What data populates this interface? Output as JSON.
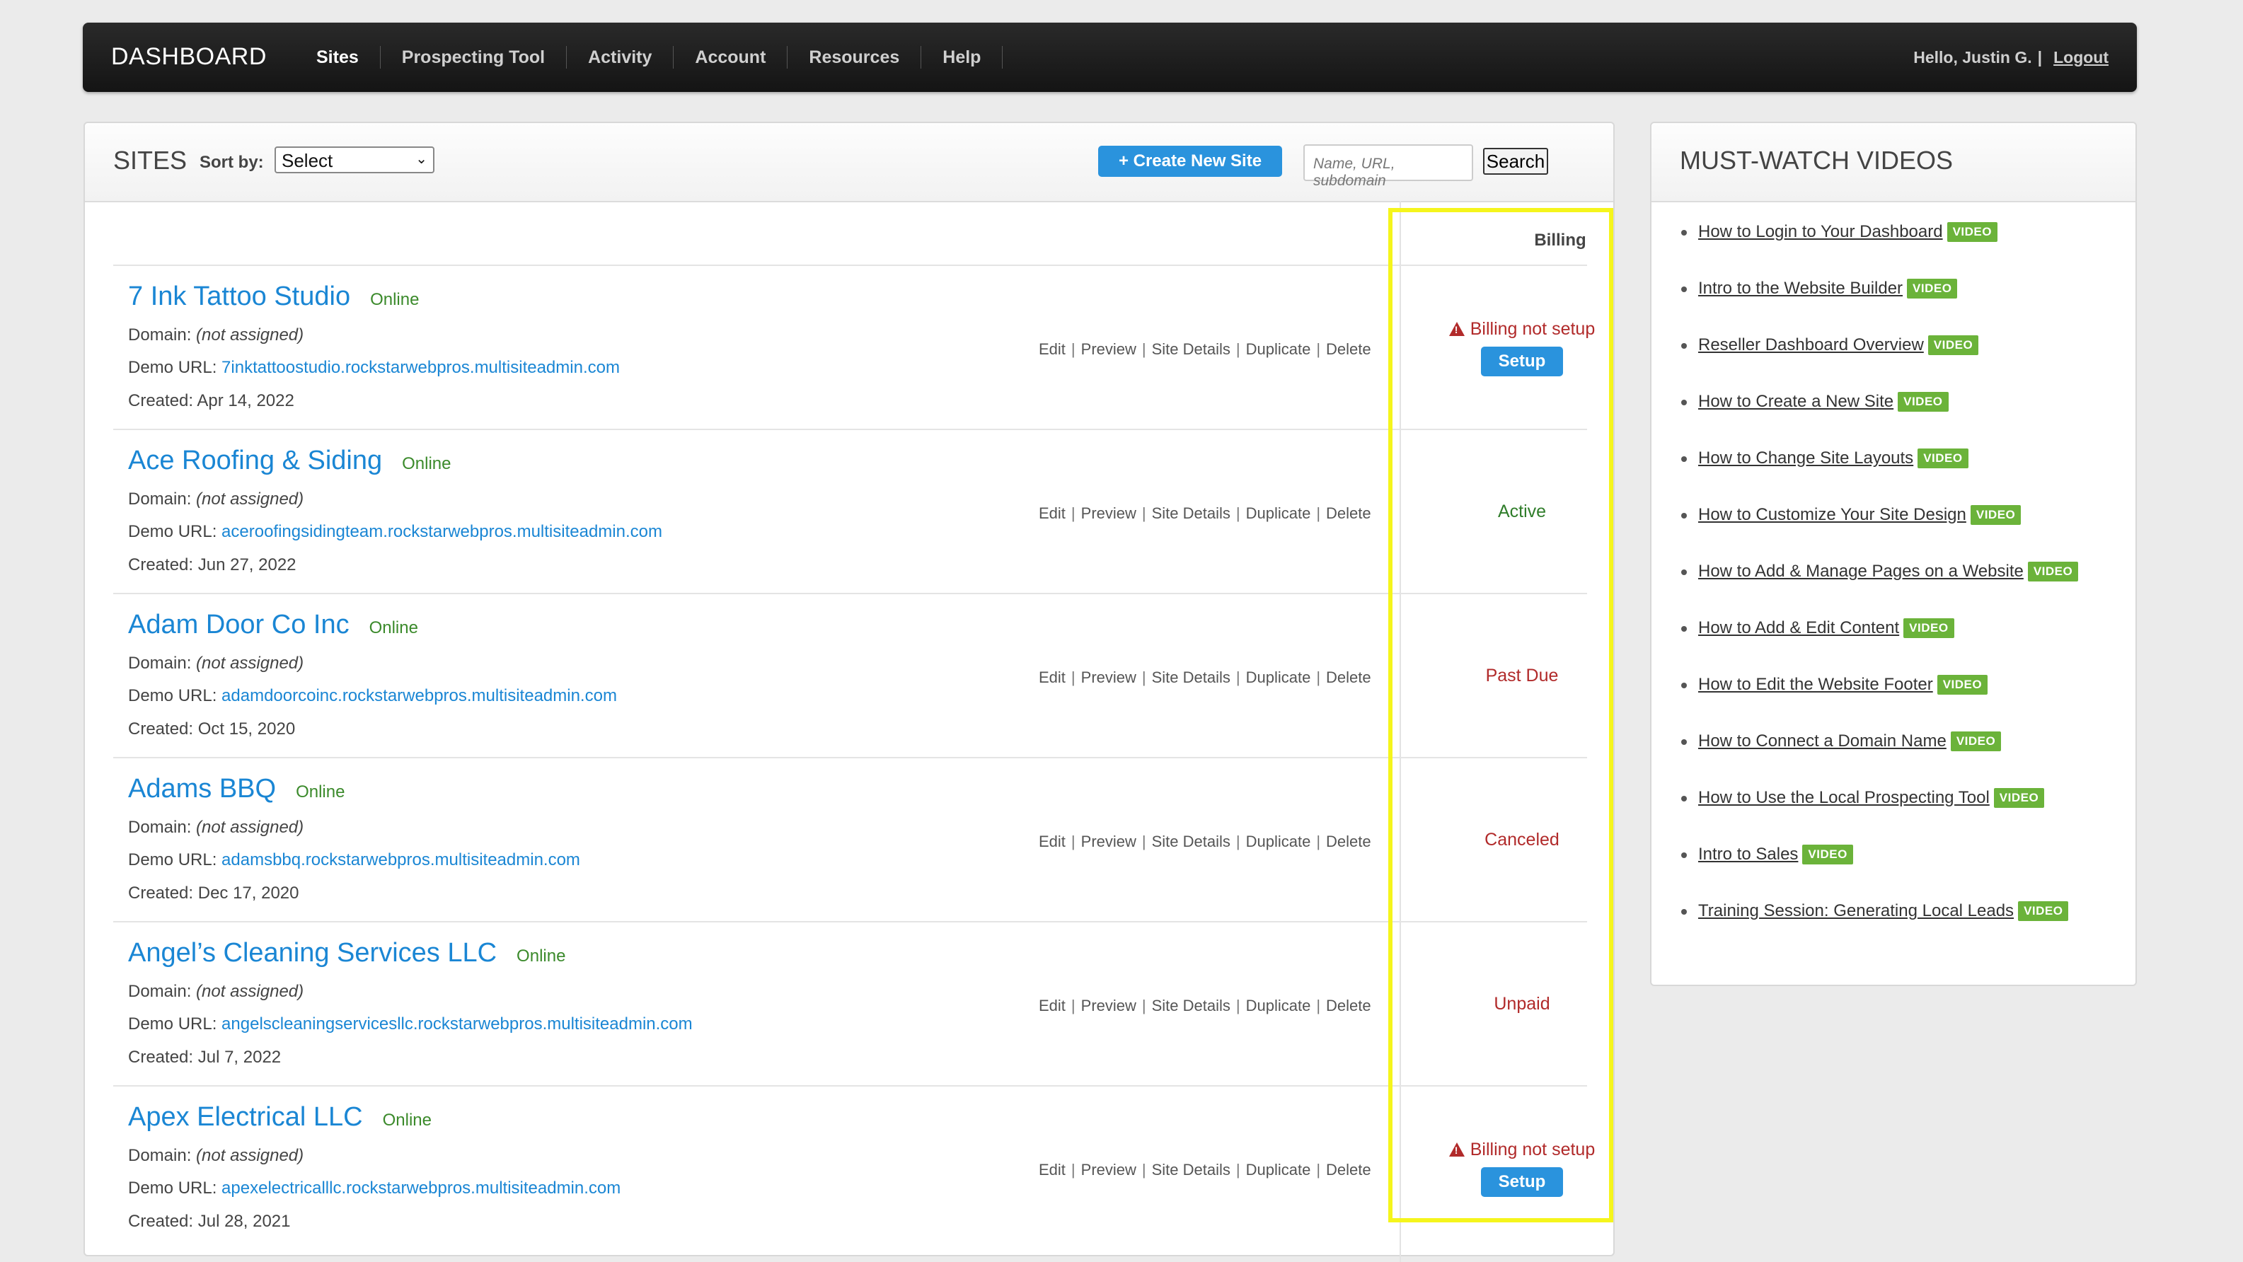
{
  "nav": {
    "brand": "DASHBOARD",
    "links": [
      "Sites",
      "Prospecting Tool",
      "Activity",
      "Account",
      "Resources",
      "Help"
    ],
    "greeting": "Hello, Justin G.",
    "pipe": "|",
    "logout": "Logout"
  },
  "sites": {
    "title": "SITES",
    "sort_label": "Sort by:",
    "sort_value": "Select",
    "create_button": "+ Create New Site",
    "search_placeholder": "Name, URL, subdomain",
    "search_button": "Search",
    "billing_header": "Billing",
    "domain_label": "Domain:",
    "demo_label": "Demo URL:",
    "created_label": "Created:",
    "actions": [
      "Edit",
      "Preview",
      "Site Details",
      "Duplicate",
      "Delete"
    ],
    "rows": [
      {
        "name": "7 Ink Tattoo Studio",
        "status": "Online",
        "domain": "(not assigned)",
        "demo_url": "7inktattoostudio.rockstarwebpros.multisiteadmin.com",
        "created": "Apr 14, 2022",
        "billing": "Billing not setup",
        "billing_action": "Setup"
      },
      {
        "name": "Ace Roofing & Siding",
        "status": "Online",
        "domain": "(not assigned)",
        "demo_url": "aceroofingsidingteam.rockstarwebpros.multisiteadmin.com",
        "created": "Jun 27, 2022",
        "billing": "Active",
        "billing_action": ""
      },
      {
        "name": "Adam Door Co Inc",
        "status": "Online",
        "domain": "(not assigned)",
        "demo_url": "adamdoorcoinc.rockstarwebpros.multisiteadmin.com",
        "created": "Oct 15, 2020",
        "billing": "Past Due",
        "billing_action": ""
      },
      {
        "name": "Adams BBQ",
        "status": "Online",
        "domain": "(not assigned)",
        "demo_url": "adamsbbq.rockstarwebpros.multisiteadmin.com",
        "created": "Dec 17, 2020",
        "billing": "Canceled",
        "billing_action": ""
      },
      {
        "name": "Angel’s Cleaning Services LLC",
        "status": "Online",
        "domain": "(not assigned)",
        "demo_url": "angelscleaningservicesllc.rockstarwebpros.multisiteadmin.com",
        "created": "Jul 7, 2022",
        "billing": "Unpaid",
        "billing_action": ""
      },
      {
        "name": "Apex Electrical LLC",
        "status": "Online",
        "domain": "(not assigned)",
        "demo_url": "apexelectricalllc.rockstarwebpros.multisiteadmin.com",
        "created": "Jul 28, 2021",
        "billing": "Billing not setup",
        "billing_action": "Setup"
      }
    ]
  },
  "videos": {
    "title": "MUST-WATCH VIDEOS",
    "badge": "VIDEO",
    "items": [
      "How to Login to Your Dashboard",
      "Intro to the Website Builder",
      "Reseller Dashboard Overview",
      "How to Create a New Site",
      "How to Change Site Layouts",
      "How to Customize Your Site Design",
      "How to Add & Manage Pages on a Website",
      "How to Add & Edit Content",
      "How to Edit the Website Footer",
      "How to Connect a Domain Name",
      "How to Use the Local Prospecting Tool",
      "Intro to Sales",
      "Training Session: Generating Local Leads"
    ]
  },
  "colors": {
    "accent": "#2a93dd",
    "link": "#1a86d4",
    "online": "#3b8a2b",
    "warning": "#b12a2a",
    "highlight": "#f5f51c",
    "badge": "#6bb33a"
  }
}
